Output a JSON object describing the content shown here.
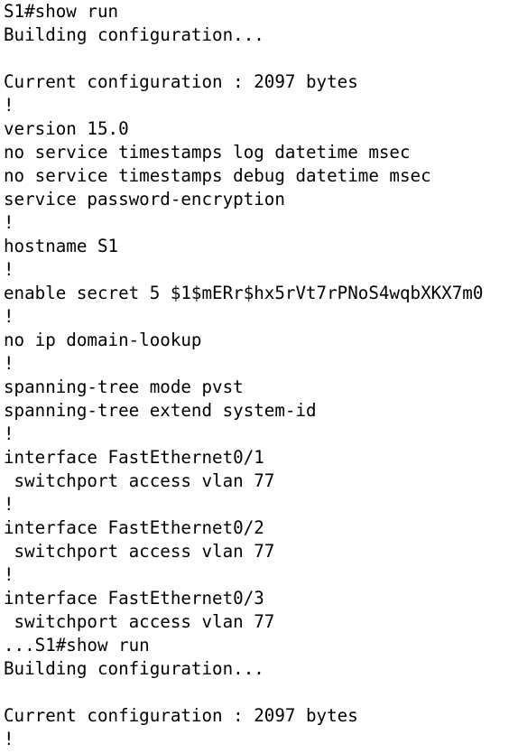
{
  "terminal": {
    "lines": [
      "S1#show run",
      "Building configuration...",
      "",
      "Current configuration : 2097 bytes",
      "!",
      "version 15.0",
      "no service timestamps log datetime msec",
      "no service timestamps debug datetime msec",
      "service password-encryption",
      "!",
      "hostname S1",
      "!",
      "enable secret 5 $1$mERr$hx5rVt7rPNoS4wqbXKX7m0",
      "!",
      "no ip domain-lookup",
      "!",
      "spanning-tree mode pvst",
      "spanning-tree extend system-id",
      "!",
      "interface FastEthernet0/1",
      " switchport access vlan 77",
      "!",
      "interface FastEthernet0/2",
      " switchport access vlan 77",
      "!",
      "interface FastEthernet0/3",
      " switchport access vlan 77",
      "...S1#show run",
      "Building configuration...",
      "",
      "Current configuration : 2097 bytes",
      "!"
    ]
  }
}
